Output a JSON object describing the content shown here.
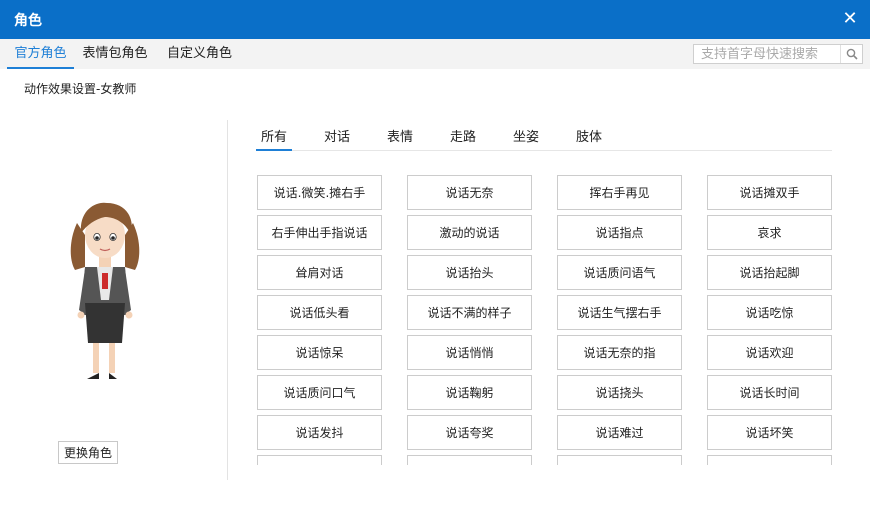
{
  "window": {
    "title": "角色",
    "close_icon": "close-icon"
  },
  "tabs": [
    {
      "label": "官方角色",
      "active": true
    },
    {
      "label": "表情包角色",
      "active": false
    },
    {
      "label": "自定义角色",
      "active": false
    }
  ],
  "search": {
    "placeholder": "支持首字母快速搜索",
    "value": "",
    "icon": "search-icon"
  },
  "section_title": "动作效果设置-女教师",
  "change_button": "更换角色",
  "categories": [
    {
      "label": "所有",
      "active": true
    },
    {
      "label": "对话",
      "active": false
    },
    {
      "label": "表情",
      "active": false
    },
    {
      "label": "走路",
      "active": false
    },
    {
      "label": "坐姿",
      "active": false
    },
    {
      "label": "肢体",
      "active": false
    }
  ],
  "actions": [
    "说话.微笑.摊右手",
    "说话无奈",
    "挥右手再见",
    "说话摊双手",
    "右手伸出手指说话",
    "激动的说话",
    "说话指点",
    "哀求",
    "耸肩对话",
    "说话抬头",
    "说话质问语气",
    "说话抬起脚",
    "说话低头看",
    "说话不满的样子",
    "说话生气摆右手",
    "说话吃惊",
    "说话惊呆",
    "说话悄悄",
    "说话无奈的指",
    "说话欢迎",
    "说话质问口气",
    "说话鞠躬",
    "说话挠头",
    "说话长时间",
    "说话发抖",
    "说话夸奖",
    "说话难过",
    "说话坏笑",
    "",
    "",
    "",
    ""
  ],
  "colors": {
    "accent": "#0a6fc8",
    "tab_active": "#1e7fd6"
  }
}
